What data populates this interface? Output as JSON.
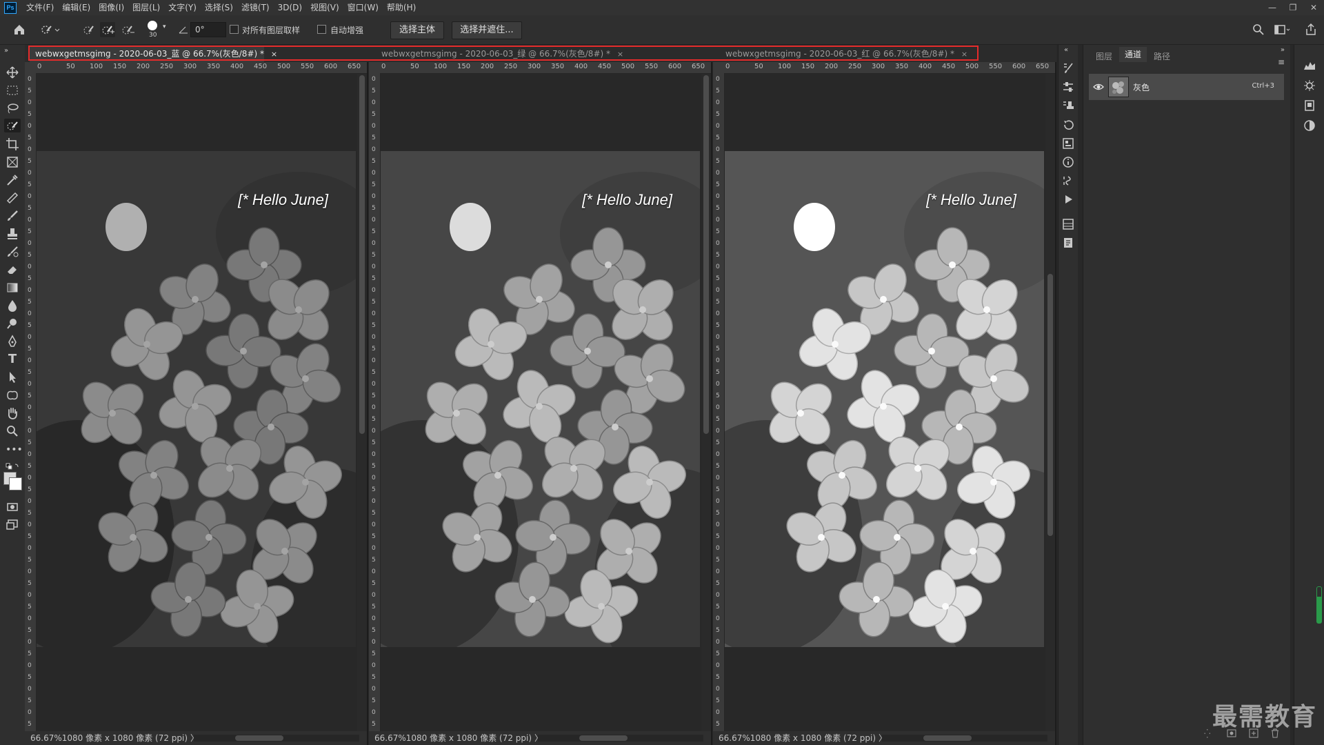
{
  "menubar": {
    "items": [
      "文件(F)",
      "编辑(E)",
      "图像(I)",
      "图层(L)",
      "文字(Y)",
      "选择(S)",
      "滤镜(T)",
      "3D(D)",
      "视图(V)",
      "窗口(W)",
      "帮助(H)"
    ],
    "window_controls": [
      "—",
      "❐",
      "✕"
    ]
  },
  "options": {
    "brush_size": "30",
    "angle": "0°",
    "sample_all_layers": "对所有图层取样",
    "auto_enhance": "自动增强",
    "select_subject": "选择主体",
    "select_and_mask": "选择并遮住..."
  },
  "tabs": [
    {
      "label": "webwxgetmsgimg - 2020-06-03_蓝 @ 66.7%(灰色/8#) *",
      "close": "×"
    },
    {
      "label": "webwxgetmsgimg - 2020-06-03_绿 @ 66.7%(灰色/8#) *",
      "close": "×"
    },
    {
      "label": "webwxgetmsgimg - 2020-06-03_红 @ 66.7%(灰色/8#) *",
      "close": "×"
    }
  ],
  "ruler_h": [
    "0",
    "50",
    "100",
    "150",
    "200",
    "250",
    "300",
    "350",
    "400",
    "450",
    "500",
    "550",
    "600",
    "650"
  ],
  "ruler_v": [
    "0",
    "5",
    "0",
    "5",
    "0",
    "5",
    "0",
    "5",
    "0",
    "5",
    "0",
    "5",
    "0",
    "5",
    "0",
    "5",
    "0",
    "5",
    "0",
    "5",
    "0",
    "5",
    "0",
    "5",
    "0",
    "5",
    "0",
    "5",
    "0",
    "5",
    "0",
    "5",
    "0",
    "5",
    "0",
    "5",
    "0",
    "5",
    "0",
    "5",
    "0",
    "5",
    "0",
    "5",
    "0",
    "5",
    "0",
    "5",
    "0",
    "5",
    "0",
    "5",
    "0",
    "5",
    "0",
    "5"
  ],
  "image": {
    "overlay_text": "[* Hello June]"
  },
  "status": {
    "zoom": "66.67%",
    "doc_info": "1080 像素 x 1080 像素 (72 ppi)"
  },
  "panel": {
    "tabs": [
      "图层",
      "通道",
      "路径"
    ],
    "active_tab": "通道",
    "channel_name": "灰色",
    "channel_shortcut": "Ctrl+3"
  },
  "watermark": "最需教育",
  "colors": {
    "tab_highlight": "#e52b2b",
    "app_bg": "#282828"
  }
}
